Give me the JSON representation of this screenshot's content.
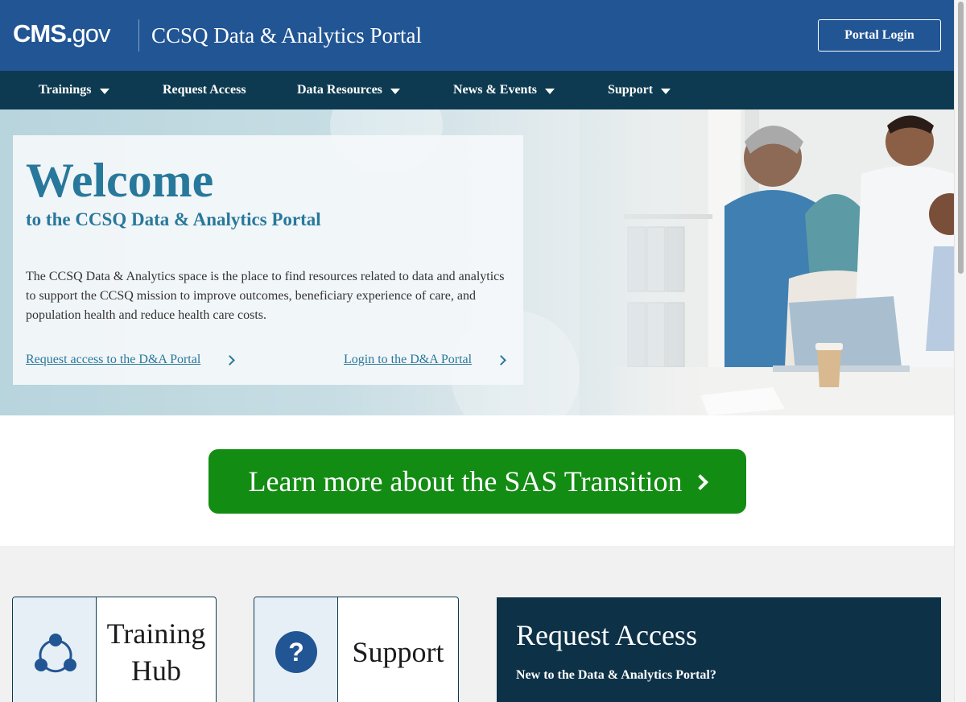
{
  "header": {
    "logo": {
      "cms": "CMS",
      "dot": ".",
      "gov": "gov"
    },
    "site_title": "CCSQ Data & Analytics Portal",
    "login_label": "Portal Login"
  },
  "nav": {
    "items": [
      {
        "label": "Trainings",
        "has_dropdown": true
      },
      {
        "label": "Request Access",
        "has_dropdown": false
      },
      {
        "label": "Data Resources",
        "has_dropdown": true
      },
      {
        "label": "News & Events",
        "has_dropdown": true
      },
      {
        "label": "Support",
        "has_dropdown": true
      }
    ]
  },
  "hero": {
    "title": "Welcome",
    "subtitle": "to the CCSQ Data & Analytics Portal",
    "description": "The CCSQ Data & Analytics space is the place to find resources related to data and analytics to support the CCSQ mission to improve outcomes, beneficiary experience of care, and population health and reduce health care costs.",
    "request_link": "Request access to the D&A Portal",
    "login_link": "Login to the D&A Portal"
  },
  "banner": {
    "label": "Learn more about the SAS Transition"
  },
  "tiles": [
    {
      "line1": "Training",
      "line2": "Hub",
      "icon": "network-icon"
    },
    {
      "label": "Support",
      "icon": "question-icon"
    }
  ],
  "request_panel": {
    "title": "Request Access",
    "subtitle": "New to the Data & Analytics Portal?"
  },
  "colors": {
    "header_bg": "#215594",
    "nav_bg": "#0d3a50",
    "accent_teal": "#28789b",
    "banner_green": "#138c14",
    "panel_navy": "#0d3248"
  }
}
